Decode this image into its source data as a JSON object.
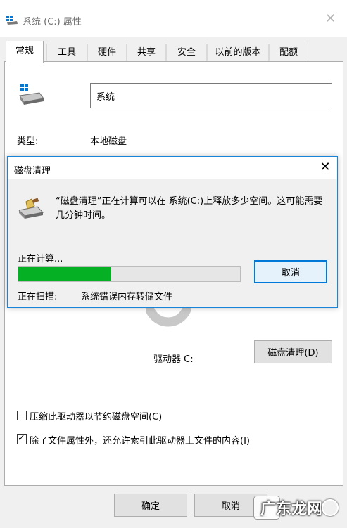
{
  "window": {
    "title": "系统 (C:) 属性",
    "close_glyph": "✕"
  },
  "tabs": [
    {
      "label": "常规",
      "active": true
    },
    {
      "label": "工具"
    },
    {
      "label": "硬件"
    },
    {
      "label": "共享"
    },
    {
      "label": "安全"
    },
    {
      "label": "以前的版本"
    },
    {
      "label": "配额"
    }
  ],
  "general": {
    "volume_name": "系统",
    "type_label": "类型:",
    "type_value": "本地磁盘",
    "drive_caption": "驱动器 C:",
    "cleanup_button": "磁盘清理(D)",
    "compress_label": "压缩此驱动器以节约磁盘空间(C)",
    "compress_checked": false,
    "index_label": "除了文件属性外，还允许索引此驱动器上文件的内容(I)",
    "index_checked": true,
    "check_glyph": "✓"
  },
  "footer": {
    "ok": "确定",
    "cancel": "取消"
  },
  "dialog": {
    "title": "磁盘清理",
    "close_glyph": "✕",
    "message": "“磁盘清理”正在计算可以在 系统(C:)上释放多少空间。这可能需要几分钟时间。",
    "calculating": "正在计算...",
    "progress": 0.42,
    "cancel": "取消",
    "scan_label": "正在扫描:",
    "scan_value": "系统错误内存转储文件"
  },
  "watermark": {
    "text": "广东龙网"
  },
  "colors": {
    "progress_fill": "#06b025",
    "accent": "#0078d7"
  }
}
